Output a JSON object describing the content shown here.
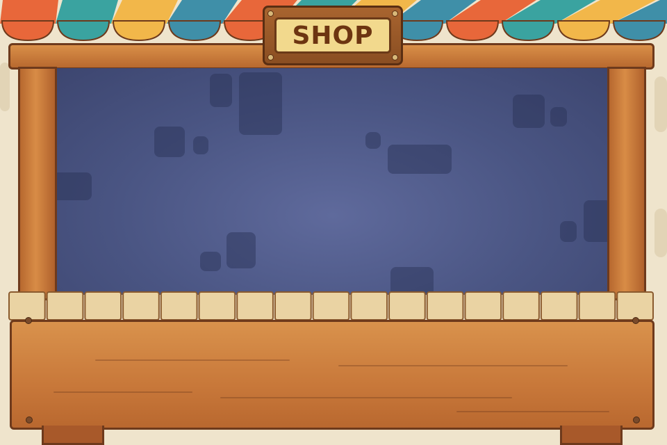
{
  "shop_sign": {
    "label": "SHOP"
  },
  "colors": {
    "awning_stripes": [
      "#e8673a",
      "#3aa3a0",
      "#f2b74a",
      "#3f8fa8"
    ],
    "wood": "#c8783a",
    "wood_outline": "#6e3a1c",
    "back_wall": "#4a5583",
    "counter_planks": "#ead3a3",
    "sign_plate": "#f2d98d",
    "sign_text": "#6d3511"
  },
  "icons": [
    "nail-icon",
    "screw-icon"
  ]
}
